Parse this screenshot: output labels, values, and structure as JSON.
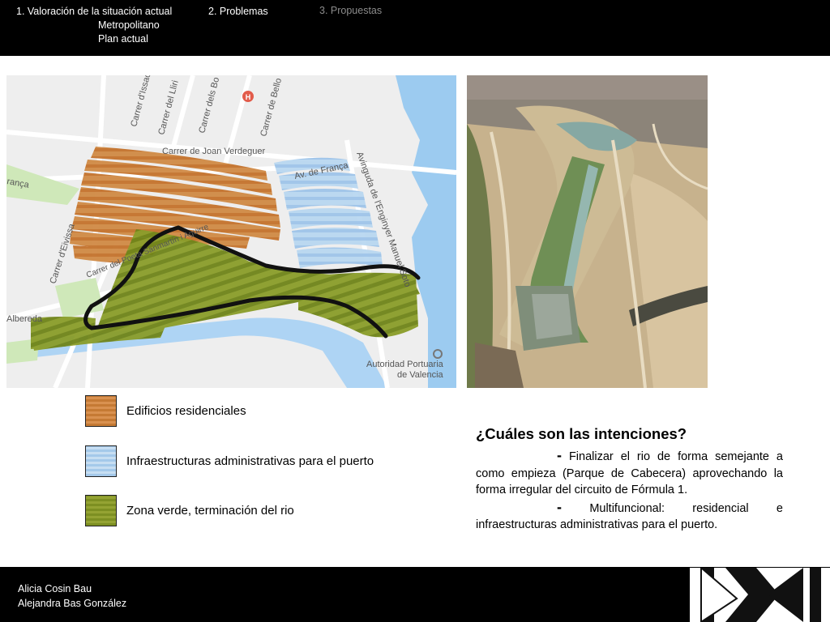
{
  "nav": {
    "item1": "1. Valoración de la situación actual",
    "item1_sub1": "Metropolitano",
    "item1_sub2": "Plan actual",
    "item2": "2. Problemas",
    "item3": "3. Propuestas"
  },
  "map": {
    "labels": {
      "issac": "Carrer d'Issac",
      "lliri": "Carrer del Lliri",
      "bo": "Carrer dels Bo",
      "bello": "Carrer de Bello",
      "joan": "Carrer de Joan Verdeguer",
      "franca_left": "rança",
      "av_franca": "Av. de França",
      "avinguda": "Avinguda de l'Enginyer Manuel Soto",
      "poeta": "Carrer del Poeta Sanmartín i Aguirre",
      "eivissa": "Carrer d'Eivissa",
      "albereda": "Albereda",
      "autoridad1": "Autoridad Portuaria",
      "autoridad2": "de Valencia",
      "hospital": "H"
    },
    "colors": {
      "residential": "#c8772f",
      "administrative": "#a9cdef",
      "green": "#778a1e",
      "water": "#9ccbf0",
      "route": "#111111"
    }
  },
  "legend": [
    {
      "label": "Edificios residenciales",
      "color": "#c8772f"
    },
    {
      "label": "Infraestructuras administrativas para el puerto",
      "color": "#a9cdef"
    },
    {
      "label": "Zona verde, terminación del rio",
      "color": "#778a1e"
    }
  ],
  "intentions": {
    "title": "¿Cuáles son las intenciones?",
    "dash": "-",
    "point1": "Finalizar el rio de forma semejante a como empieza (Parque de Cabecera) aprovechando la forma irregular del circuito de Fórmula 1.",
    "point2": "Multifuncional: residencial e infraestructuras administrativas para el puerto."
  },
  "footer": {
    "author1": "Alicia Cosin Bau",
    "author2": "Alejandra Bas González"
  }
}
